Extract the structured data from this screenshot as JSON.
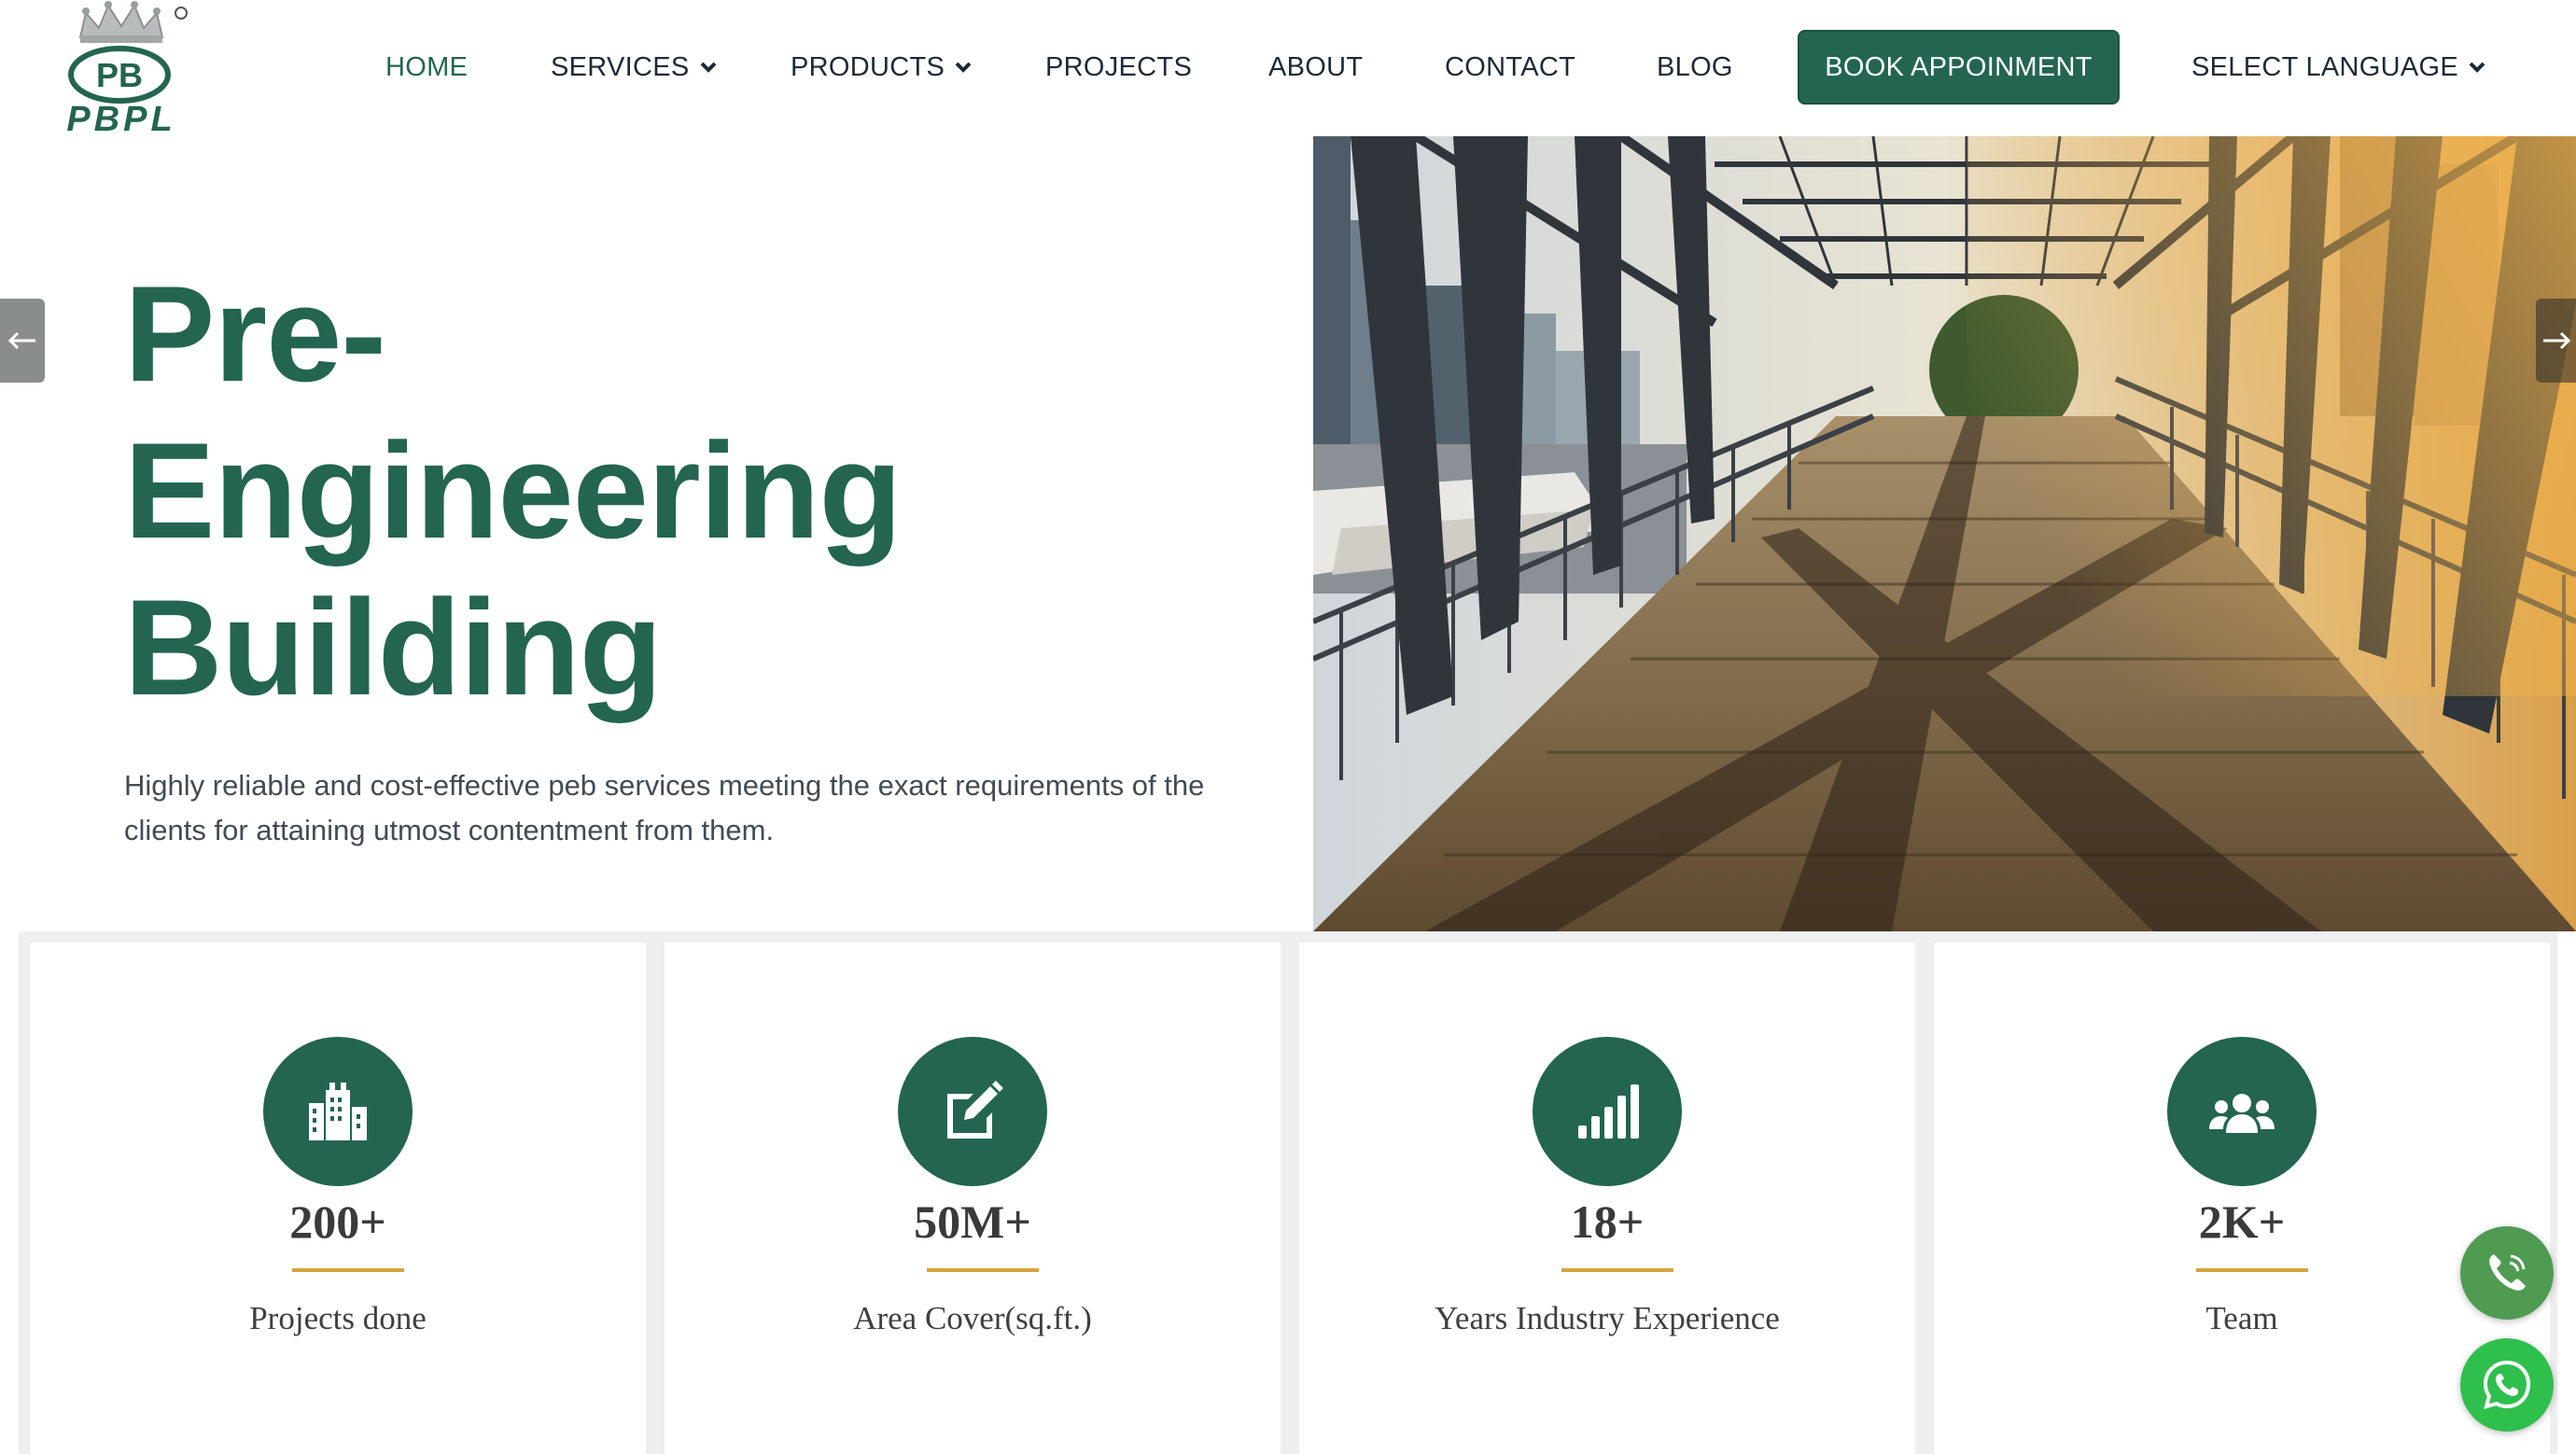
{
  "header": {
    "logo_text": "PBPL",
    "logo_badge": "PB",
    "nav": [
      {
        "label": "HOME",
        "active": true,
        "dropdown": false
      },
      {
        "label": "SERVICES",
        "active": false,
        "dropdown": true
      },
      {
        "label": "PRODUCTS",
        "active": false,
        "dropdown": true
      },
      {
        "label": "PROJECTS",
        "active": false,
        "dropdown": false
      },
      {
        "label": "ABOUT",
        "active": false,
        "dropdown": false
      },
      {
        "label": "CONTACT",
        "active": false,
        "dropdown": false
      },
      {
        "label": "BLOG",
        "active": false,
        "dropdown": false
      }
    ],
    "book_button": "BOOK APPOINMENT",
    "language_select": "SELECT LANGUAGE"
  },
  "hero": {
    "title_lines": [
      "Pre-",
      "Engineering",
      "Building"
    ],
    "description": "Highly reliable and cost-effective peb services meeting the exact requirements of the clients for attaining utmost contentment from them.",
    "image": "steel truss footbridge"
  },
  "stats": [
    {
      "icon": "building-icon",
      "value": "200+",
      "label": "Projects done"
    },
    {
      "icon": "edit-icon",
      "value": "50M+",
      "label": "Area Cover(sq.ft.)"
    },
    {
      "icon": "signal-bars-icon",
      "value": "18+",
      "label": "Years Industry Experience"
    },
    {
      "icon": "team-icon",
      "value": "2K+",
      "label": "Team"
    }
  ],
  "floating": {
    "phone": "phone-icon",
    "whatsapp": "whatsapp-icon"
  },
  "colors": {
    "brand": "#236550",
    "accent": "#d7a43b",
    "text": "#1d2a36",
    "body_text": "#434b53",
    "stats_bg": "#efefef",
    "phone_fab": "#4f9b52",
    "whatsapp_fab": "#2fbf4d"
  }
}
